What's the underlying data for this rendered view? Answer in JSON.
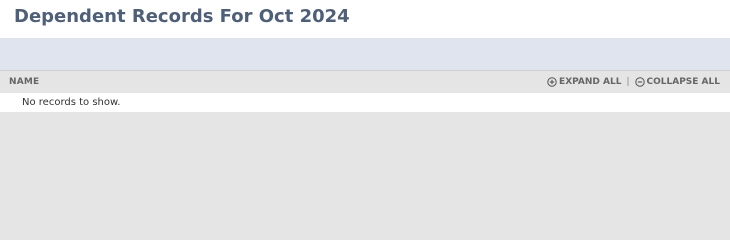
{
  "page": {
    "title": "Dependent Records For Oct 2024"
  },
  "table": {
    "column_name": "NAME",
    "expand_all_label": "EXPAND ALL",
    "separator": "|",
    "collapse_all_label": "COLLAPSE ALL",
    "empty_message": "No records to show."
  },
  "colors": {
    "title": "#4d5f79",
    "band": "#dfe4ee",
    "background": "#e5e5e5"
  },
  "icons": {
    "expand": "plus-circle-icon",
    "collapse": "minus-circle-icon"
  }
}
